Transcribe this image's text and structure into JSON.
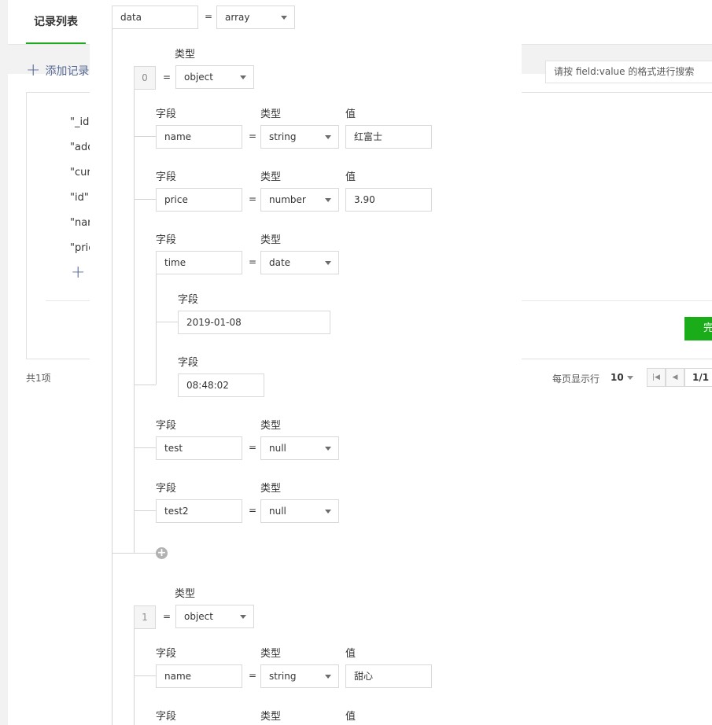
{
  "background": {
    "tab_label": "记录列表",
    "add_record_label": "添加记录",
    "search_placeholder": "请按 field:value 的格式进行搜索",
    "record_lines": [
      "\"_id",
      "\"add",
      "\"cur",
      "\"id\":",
      "\"nar",
      "\"pric"
    ],
    "confirm_fragment": "完",
    "total_text": "共1项",
    "per_page_label": "每页显示行",
    "per_page_value": "10",
    "page_indicator": "1/1",
    "accent_color": "#1aad19"
  },
  "labels": {
    "type": "类型",
    "field": "字段",
    "value": "值",
    "equals": "="
  },
  "root": {
    "name": "data",
    "type": "array"
  },
  "items": [
    {
      "index": "0",
      "type": "object",
      "fields": {
        "name": {
          "name": "name",
          "type": "string",
          "value": "红富士"
        },
        "price": {
          "name": "price",
          "type": "number",
          "value": "3.90"
        },
        "time": {
          "name": "time",
          "type": "date",
          "date": "2019-01-08",
          "clock": "08:48:02"
        },
        "test": {
          "name": "test",
          "type": "null"
        },
        "test2": {
          "name": "test2",
          "type": "null"
        }
      }
    },
    {
      "index": "1",
      "type": "object",
      "fields": {
        "name": {
          "name": "name",
          "type": "string",
          "value": "甜心"
        }
      }
    }
  ],
  "icons": {
    "add_field": "plus-circle-icon",
    "dropdown": "chevron-down-icon",
    "add_record": "plus-icon"
  }
}
